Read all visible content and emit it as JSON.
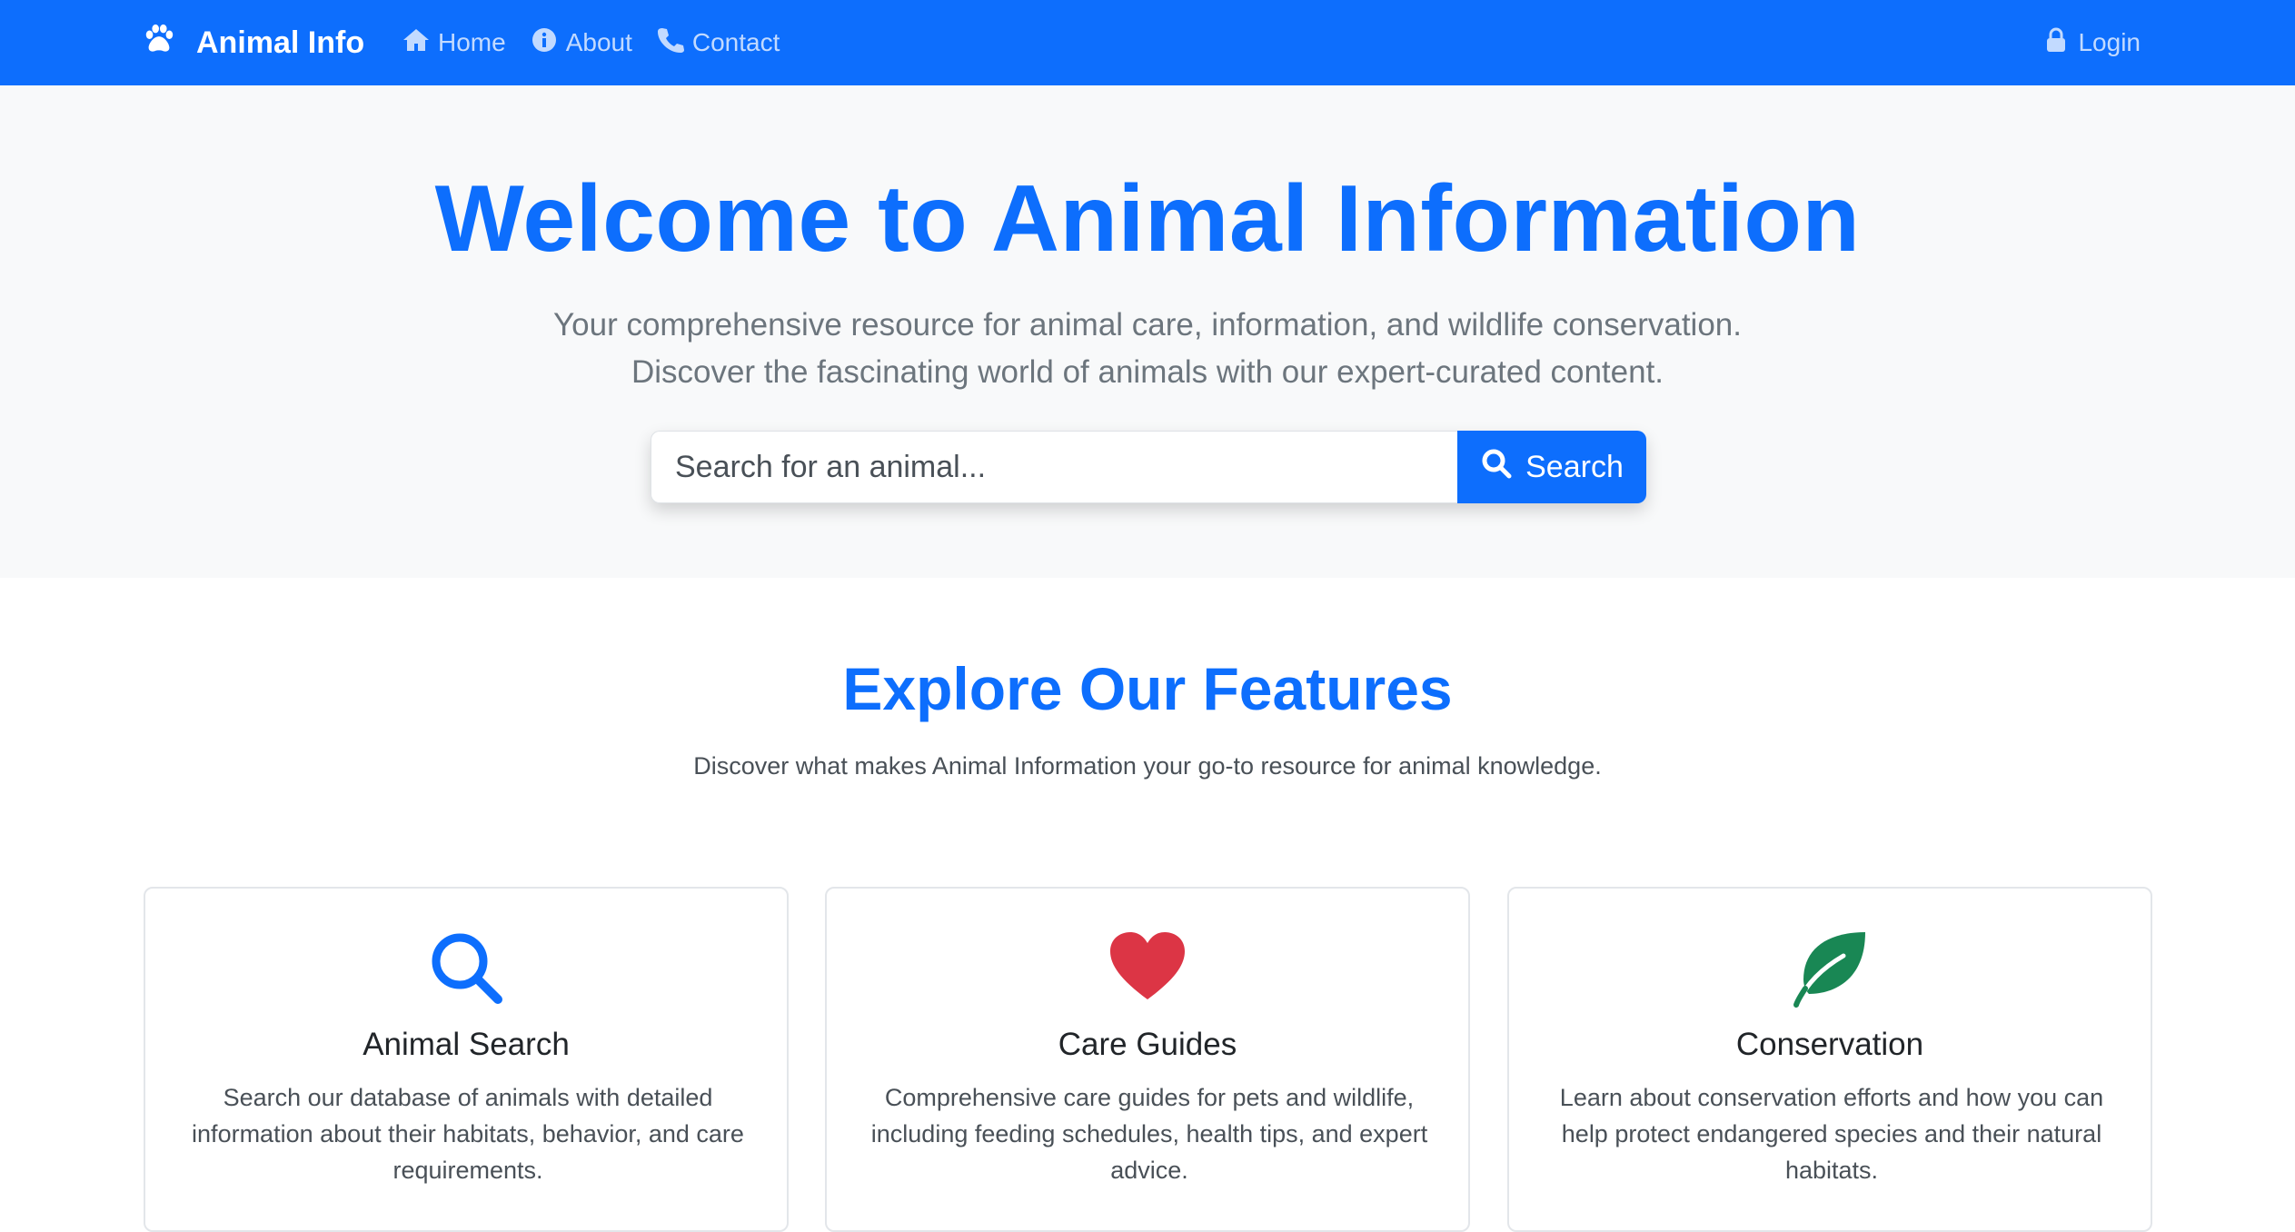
{
  "navbar": {
    "brand": "Animal Info",
    "links": [
      {
        "label": "Home",
        "icon": "home-icon"
      },
      {
        "label": "About",
        "icon": "info-circle-icon"
      },
      {
        "label": "Contact",
        "icon": "phone-icon"
      }
    ],
    "login": {
      "label": "Login",
      "icon": "lock-icon"
    }
  },
  "hero": {
    "title": "Welcome to Animal Information",
    "subtitle": "Your comprehensive resource for animal care, information, and wildlife conservation. Discover the fascinating world of animals with our expert-curated content.",
    "search_placeholder": "Search for an animal...",
    "search_button": "Search"
  },
  "features": {
    "title": "Explore Our Features",
    "subtitle": "Discover what makes Animal Information your go-to resource for animal knowledge.",
    "cards": [
      {
        "icon": "search-icon",
        "title": "Animal Search",
        "text": "Search our database of animals with detailed information about their habitats, behavior, and care requirements."
      },
      {
        "icon": "heart-icon",
        "title": "Care Guides",
        "text": "Comprehensive care guides for pets and wildlife, including feeding schedules, health tips, and expert advice."
      },
      {
        "icon": "leaf-icon",
        "title": "Conservation",
        "text": "Learn about conservation efforts and how you can help protect endangered species and their natural habitats."
      }
    ]
  },
  "colors": {
    "primary": "#0d6efd",
    "hero_bg": "#f8f9fa",
    "heart": "#dc3545",
    "leaf": "#198754"
  }
}
